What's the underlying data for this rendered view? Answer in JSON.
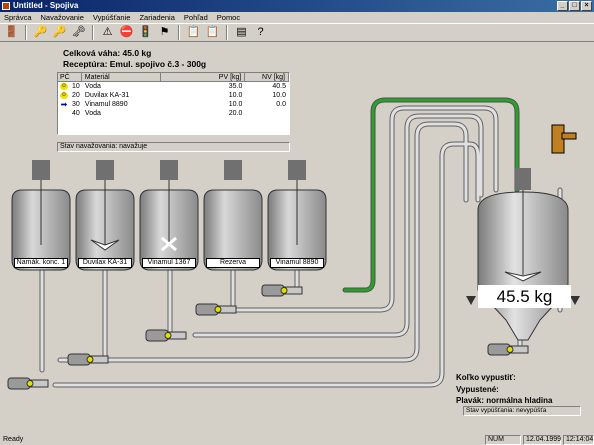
{
  "window": {
    "title": "Untitled - Spojiva",
    "minimize": "_",
    "maximize": "□",
    "close": "×"
  },
  "menu": [
    "Správca",
    "Navažovanie",
    "Vypúšťanie",
    "Zariadenia",
    "Pohľad",
    "Pomoc"
  ],
  "toolbar": {
    "icons": [
      "exit-icon",
      "key-icon",
      "key-arrow-icon",
      "key-cross-icon",
      "warning-icon",
      "stop-icon",
      "traffic-light-icon",
      "flag-icon",
      "copy-icon",
      "copy2-icon",
      "form-icon",
      "help-icon"
    ],
    "glyphs": [
      "🚪",
      "🔑",
      "🔑",
      "🗝",
      "⚠",
      "⛔",
      "🚦",
      "⚑",
      "📋",
      "📋",
      "▤",
      "?"
    ]
  },
  "header": {
    "total_weight": "Celková váha: 45.0 kg",
    "recipe": "Receptúra: Emul. spojivo č.3 - 300g"
  },
  "table": {
    "headers": [
      "PČ",
      "Materiál",
      "PV [kg]",
      "NV [kg]"
    ],
    "rows": [
      {
        "pc": "10",
        "material": "Voda",
        "pv": "35.0",
        "nv": "40.5",
        "icon": "smiley-icon"
      },
      {
        "pc": "20",
        "material": "Duvilax KA-31",
        "pv": "10.0",
        "nv": "10.0",
        "icon": "smiley-icon"
      },
      {
        "pc": "30",
        "material": "Vinamul 8890",
        "pv": "10.0",
        "nv": "0.0",
        "icon": "arrow-right-icon"
      },
      {
        "pc": "40",
        "material": "Voda",
        "pv": "20.0",
        "nv": "",
        "icon": ""
      }
    ]
  },
  "weighing_status": "Stav navažovania: navažuje",
  "tanks": [
    "Namák. konc. 1",
    "Duvilax KA-31",
    "Vinamul 1367",
    "Rezerva",
    "Vinamul 8890"
  ],
  "mixer": {
    "weight": "45.5 kg"
  },
  "discharge": {
    "how_much": "Koľko vypustiť:",
    "discharged": "Vypustené:",
    "float": "Plavák: normálna hladina",
    "status": "Stav vypúšťania: nevypúšťa"
  },
  "statusbar": {
    "ready": "Ready",
    "num": "NUM",
    "date": "12.04.1999",
    "time": "12:14:04"
  },
  "colors": {
    "pipe_active": "#2aa02a",
    "pipe": "#c8c8c8",
    "tank": "#b4b4b4",
    "titlebar": "#0a246a"
  }
}
